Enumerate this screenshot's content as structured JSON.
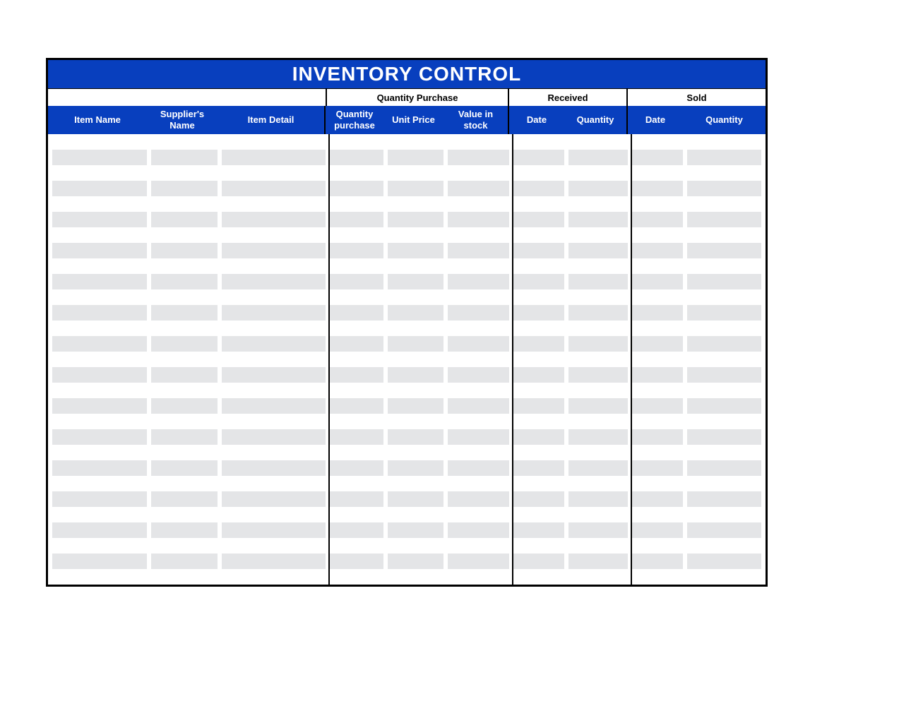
{
  "title": "INVENTORY CONTROL",
  "groupHeaders": {
    "quantityPurchase": "Quantity Purchase",
    "received": "Received",
    "sold": "Sold"
  },
  "columns": {
    "itemName": "Item Name",
    "supplierName": "Supplier's Name",
    "itemDetail": "Item Detail",
    "quantityPurchase": "Quantity purchase",
    "unitPrice": "Unit Price",
    "valueInStock": "Value in stock",
    "receivedDate": "Date",
    "receivedQty": "Quantity",
    "soldDate": "Date",
    "soldQty": "Quantity"
  },
  "rows": [
    {
      "itemName": "",
      "supplierName": "",
      "itemDetail": "",
      "quantityPurchase": "",
      "unitPrice": "",
      "valueInStock": "",
      "receivedDate": "",
      "receivedQty": "",
      "soldDate": "",
      "soldQty": ""
    },
    {
      "itemName": "",
      "supplierName": "",
      "itemDetail": "",
      "quantityPurchase": "",
      "unitPrice": "",
      "valueInStock": "",
      "receivedDate": "",
      "receivedQty": "",
      "soldDate": "",
      "soldQty": ""
    },
    {
      "itemName": "",
      "supplierName": "",
      "itemDetail": "",
      "quantityPurchase": "",
      "unitPrice": "",
      "valueInStock": "",
      "receivedDate": "",
      "receivedQty": "",
      "soldDate": "",
      "soldQty": ""
    },
    {
      "itemName": "",
      "supplierName": "",
      "itemDetail": "",
      "quantityPurchase": "",
      "unitPrice": "",
      "valueInStock": "",
      "receivedDate": "",
      "receivedQty": "",
      "soldDate": "",
      "soldQty": ""
    },
    {
      "itemName": "",
      "supplierName": "",
      "itemDetail": "",
      "quantityPurchase": "",
      "unitPrice": "",
      "valueInStock": "",
      "receivedDate": "",
      "receivedQty": "",
      "soldDate": "",
      "soldQty": ""
    },
    {
      "itemName": "",
      "supplierName": "",
      "itemDetail": "",
      "quantityPurchase": "",
      "unitPrice": "",
      "valueInStock": "",
      "receivedDate": "",
      "receivedQty": "",
      "soldDate": "",
      "soldQty": ""
    },
    {
      "itemName": "",
      "supplierName": "",
      "itemDetail": "",
      "quantityPurchase": "",
      "unitPrice": "",
      "valueInStock": "",
      "receivedDate": "",
      "receivedQty": "",
      "soldDate": "",
      "soldQty": ""
    },
    {
      "itemName": "",
      "supplierName": "",
      "itemDetail": "",
      "quantityPurchase": "",
      "unitPrice": "",
      "valueInStock": "",
      "receivedDate": "",
      "receivedQty": "",
      "soldDate": "",
      "soldQty": ""
    },
    {
      "itemName": "",
      "supplierName": "",
      "itemDetail": "",
      "quantityPurchase": "",
      "unitPrice": "",
      "valueInStock": "",
      "receivedDate": "",
      "receivedQty": "",
      "soldDate": "",
      "soldQty": ""
    },
    {
      "itemName": "",
      "supplierName": "",
      "itemDetail": "",
      "quantityPurchase": "",
      "unitPrice": "",
      "valueInStock": "",
      "receivedDate": "",
      "receivedQty": "",
      "soldDate": "",
      "soldQty": ""
    },
    {
      "itemName": "",
      "supplierName": "",
      "itemDetail": "",
      "quantityPurchase": "",
      "unitPrice": "",
      "valueInStock": "",
      "receivedDate": "",
      "receivedQty": "",
      "soldDate": "",
      "soldQty": ""
    },
    {
      "itemName": "",
      "supplierName": "",
      "itemDetail": "",
      "quantityPurchase": "",
      "unitPrice": "",
      "valueInStock": "",
      "receivedDate": "",
      "receivedQty": "",
      "soldDate": "",
      "soldQty": ""
    },
    {
      "itemName": "",
      "supplierName": "",
      "itemDetail": "",
      "quantityPurchase": "",
      "unitPrice": "",
      "valueInStock": "",
      "receivedDate": "",
      "receivedQty": "",
      "soldDate": "",
      "soldQty": ""
    },
    {
      "itemName": "",
      "supplierName": "",
      "itemDetail": "",
      "quantityPurchase": "",
      "unitPrice": "",
      "valueInStock": "",
      "receivedDate": "",
      "receivedQty": "",
      "soldDate": "",
      "soldQty": ""
    },
    {
      "itemName": "",
      "supplierName": "",
      "itemDetail": "",
      "quantityPurchase": "",
      "unitPrice": "",
      "valueInStock": "",
      "receivedDate": "",
      "receivedQty": "",
      "soldDate": "",
      "soldQty": ""
    },
    {
      "itemName": "",
      "supplierName": "",
      "itemDetail": "",
      "quantityPurchase": "",
      "unitPrice": "",
      "valueInStock": "",
      "receivedDate": "",
      "receivedQty": "",
      "soldDate": "",
      "soldQty": ""
    },
    {
      "itemName": "",
      "supplierName": "",
      "itemDetail": "",
      "quantityPurchase": "",
      "unitPrice": "",
      "valueInStock": "",
      "receivedDate": "",
      "receivedQty": "",
      "soldDate": "",
      "soldQty": ""
    },
    {
      "itemName": "",
      "supplierName": "",
      "itemDetail": "",
      "quantityPurchase": "",
      "unitPrice": "",
      "valueInStock": "",
      "receivedDate": "",
      "receivedQty": "",
      "soldDate": "",
      "soldQty": ""
    },
    {
      "itemName": "",
      "supplierName": "",
      "itemDetail": "",
      "quantityPurchase": "",
      "unitPrice": "",
      "valueInStock": "",
      "receivedDate": "",
      "receivedQty": "",
      "soldDate": "",
      "soldQty": ""
    },
    {
      "itemName": "",
      "supplierName": "",
      "itemDetail": "",
      "quantityPurchase": "",
      "unitPrice": "",
      "valueInStock": "",
      "receivedDate": "",
      "receivedQty": "",
      "soldDate": "",
      "soldQty": ""
    },
    {
      "itemName": "",
      "supplierName": "",
      "itemDetail": "",
      "quantityPurchase": "",
      "unitPrice": "",
      "valueInStock": "",
      "receivedDate": "",
      "receivedQty": "",
      "soldDate": "",
      "soldQty": ""
    },
    {
      "itemName": "",
      "supplierName": "",
      "itemDetail": "",
      "quantityPurchase": "",
      "unitPrice": "",
      "valueInStock": "",
      "receivedDate": "",
      "receivedQty": "",
      "soldDate": "",
      "soldQty": ""
    },
    {
      "itemName": "",
      "supplierName": "",
      "itemDetail": "",
      "quantityPurchase": "",
      "unitPrice": "",
      "valueInStock": "",
      "receivedDate": "",
      "receivedQty": "",
      "soldDate": "",
      "soldQty": ""
    },
    {
      "itemName": "",
      "supplierName": "",
      "itemDetail": "",
      "quantityPurchase": "",
      "unitPrice": "",
      "valueInStock": "",
      "receivedDate": "",
      "receivedQty": "",
      "soldDate": "",
      "soldQty": ""
    },
    {
      "itemName": "",
      "supplierName": "",
      "itemDetail": "",
      "quantityPurchase": "",
      "unitPrice": "",
      "valueInStock": "",
      "receivedDate": "",
      "receivedQty": "",
      "soldDate": "",
      "soldQty": ""
    },
    {
      "itemName": "",
      "supplierName": "",
      "itemDetail": "",
      "quantityPurchase": "",
      "unitPrice": "",
      "valueInStock": "",
      "receivedDate": "",
      "receivedQty": "",
      "soldDate": "",
      "soldQty": ""
    },
    {
      "itemName": "",
      "supplierName": "",
      "itemDetail": "",
      "quantityPurchase": "",
      "unitPrice": "",
      "valueInStock": "",
      "receivedDate": "",
      "receivedQty": "",
      "soldDate": "",
      "soldQty": ""
    },
    {
      "itemName": "",
      "supplierName": "",
      "itemDetail": "",
      "quantityPurchase": "",
      "unitPrice": "",
      "valueInStock": "",
      "receivedDate": "",
      "receivedQty": "",
      "soldDate": "",
      "soldQty": ""
    },
    {
      "itemName": "",
      "supplierName": "",
      "itemDetail": "",
      "quantityPurchase": "",
      "unitPrice": "",
      "valueInStock": "",
      "receivedDate": "",
      "receivedQty": "",
      "soldDate": "",
      "soldQty": ""
    }
  ]
}
